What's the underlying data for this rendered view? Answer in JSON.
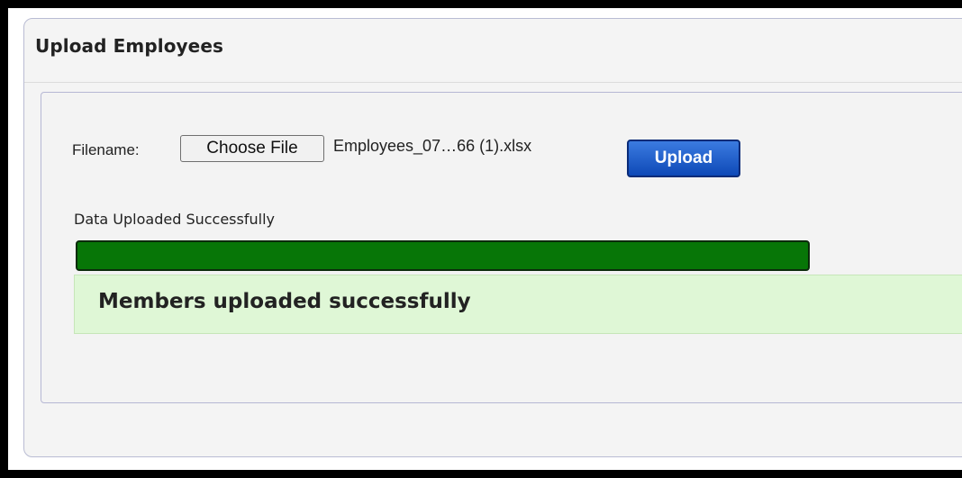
{
  "panel": {
    "title": "Upload Employees"
  },
  "upload_form": {
    "filename_label": "Filename:",
    "choose_file_label": "Choose File",
    "selected_file": "Employees_07…66 (1).xlsx",
    "upload_label": "Upload"
  },
  "status": {
    "message": "Data Uploaded Successfully",
    "progress_percent": 100,
    "progress_color": "#077607"
  },
  "alert": {
    "message": "Members uploaded successfully",
    "background_color": "#dff7d6"
  },
  "colors": {
    "upload_button": "#1152c4",
    "panel_border": "#b6b7d4"
  }
}
